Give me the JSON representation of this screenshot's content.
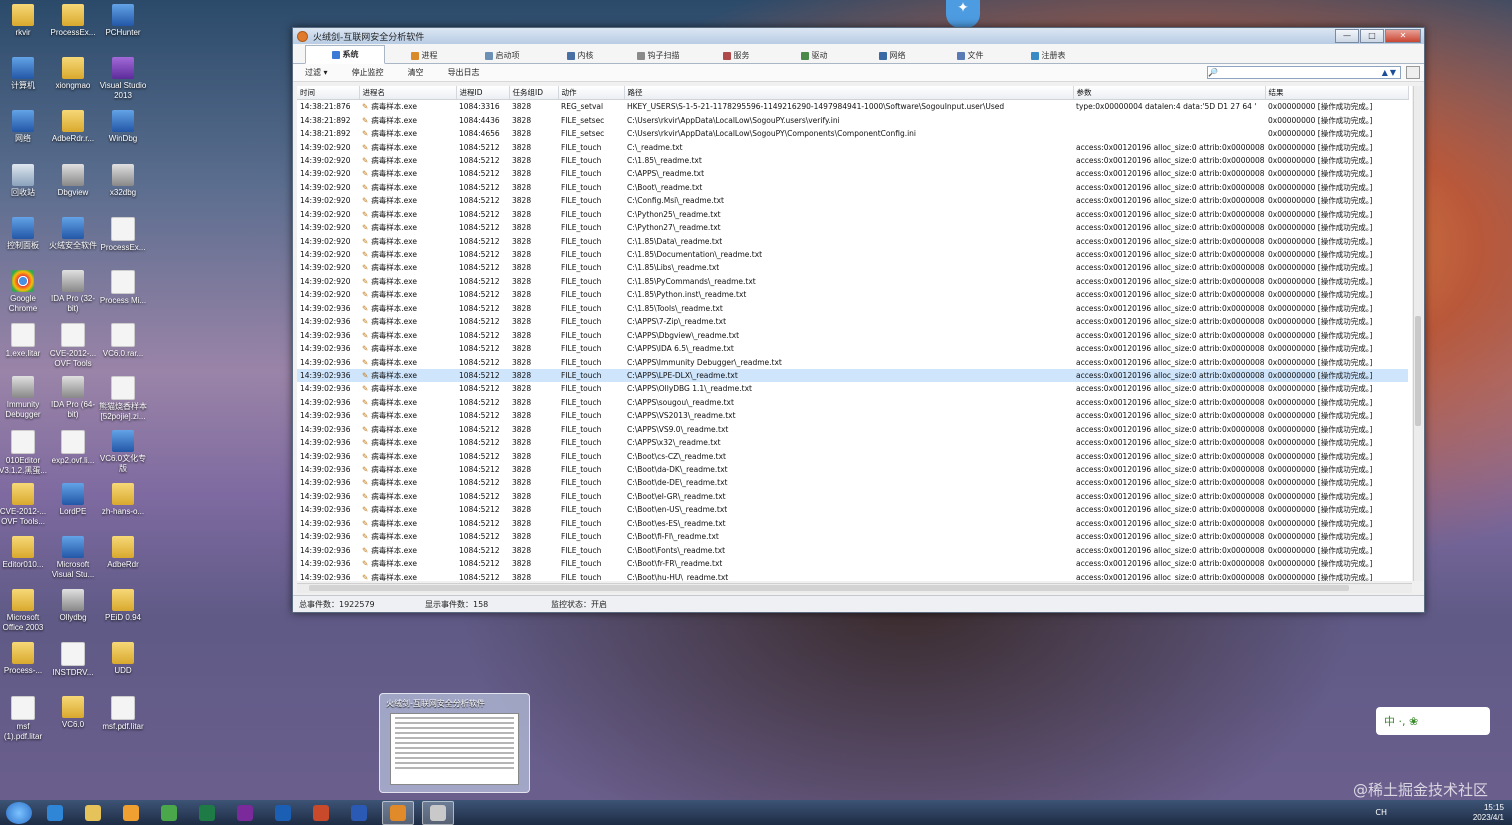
{
  "window": {
    "title": "火绒剑-互联网安全分析软件",
    "btn_min": "—",
    "btn_max": "□",
    "btn_close": "✕"
  },
  "tabs": [
    {
      "label": "系统",
      "color": "#3a7bd5"
    },
    {
      "label": "进程",
      "color": "#d98a2b"
    },
    {
      "label": "启动项",
      "color": "#6b8fb5"
    },
    {
      "label": "内核",
      "color": "#4a6fa5"
    },
    {
      "label": "钩子扫描",
      "color": "#8a8a8a"
    },
    {
      "label": "服务",
      "color": "#b04a4a"
    },
    {
      "label": "驱动",
      "color": "#4a8a4a"
    },
    {
      "label": "网络",
      "color": "#3a6aa5"
    },
    {
      "label": "文件",
      "color": "#5a7ab5"
    },
    {
      "label": "注册表",
      "color": "#3a8ac5"
    }
  ],
  "toolbar": {
    "filter": "过滤 ▾",
    "stop": "停止监控",
    "clear": "清空",
    "export": "导出日志",
    "search_icon": "🔎",
    "search_arrows": "▲▼"
  },
  "columns": [
    "时间",
    "进程名",
    "进程ID",
    "任务组ID",
    "动作",
    "路径",
    "参数",
    "结果"
  ],
  "rows": [
    [
      "14:38:21:876",
      "病毒样本.exe",
      "1084:3316",
      "3828",
      "REG_setval",
      "HKEY_USERS\\S-1-5-21-1178295596-1149216290-1497984941-1000\\Software\\SogouInput.user\\Used",
      "type:0x00000004 datalen:4 data:'5D D1 27 64 '",
      "0x00000000 [操作成功完成。]"
    ],
    [
      "14:38:21:892",
      "病毒样本.exe",
      "1084:4436",
      "3828",
      "FILE_setsec",
      "C:\\Users\\rkvir\\AppData\\LocalLow\\SogouPY.users\\verify.ini",
      "",
      "0x00000000 [操作成功完成。]"
    ],
    [
      "14:38:21:892",
      "病毒样本.exe",
      "1084:4656",
      "3828",
      "FILE_setsec",
      "C:\\Users\\rkvir\\AppData\\LocalLow\\SogouPY\\Components\\ComponentConfig.ini",
      "",
      "0x00000000 [操作成功完成。]"
    ],
    [
      "14:39:02:920",
      "病毒样本.exe",
      "1084:5212",
      "3828",
      "FILE_touch",
      "C:\\_readme.txt",
      "access:0x00120196 alloc_size:0 attrib:0x00000080...",
      "0x00000000 [操作成功完成。]"
    ],
    [
      "14:39:02:920",
      "病毒样本.exe",
      "1084:5212",
      "3828",
      "FILE_touch",
      "C:\\1.85\\_readme.txt",
      "access:0x00120196 alloc_size:0 attrib:0x00000080...",
      "0x00000000 [操作成功完成。]"
    ],
    [
      "14:39:02:920",
      "病毒样本.exe",
      "1084:5212",
      "3828",
      "FILE_touch",
      "C:\\APPS\\_readme.txt",
      "access:0x00120196 alloc_size:0 attrib:0x00000080...",
      "0x00000000 [操作成功完成。]"
    ],
    [
      "14:39:02:920",
      "病毒样本.exe",
      "1084:5212",
      "3828",
      "FILE_touch",
      "C:\\Boot\\_readme.txt",
      "access:0x00120196 alloc_size:0 attrib:0x00000080...",
      "0x00000000 [操作成功完成。]"
    ],
    [
      "14:39:02:920",
      "病毒样本.exe",
      "1084:5212",
      "3828",
      "FILE_touch",
      "C:\\Config.Msi\\_readme.txt",
      "access:0x00120196 alloc_size:0 attrib:0x00000080...",
      "0x00000000 [操作成功完成。]"
    ],
    [
      "14:39:02:920",
      "病毒样本.exe",
      "1084:5212",
      "3828",
      "FILE_touch",
      "C:\\Python25\\_readme.txt",
      "access:0x00120196 alloc_size:0 attrib:0x00000080...",
      "0x00000000 [操作成功完成。]"
    ],
    [
      "14:39:02:920",
      "病毒样本.exe",
      "1084:5212",
      "3828",
      "FILE_touch",
      "C:\\Python27\\_readme.txt",
      "access:0x00120196 alloc_size:0 attrib:0x00000080...",
      "0x00000000 [操作成功完成。]"
    ],
    [
      "14:39:02:920",
      "病毒样本.exe",
      "1084:5212",
      "3828",
      "FILE_touch",
      "C:\\1.85\\Data\\_readme.txt",
      "access:0x00120196 alloc_size:0 attrib:0x00000080...",
      "0x00000000 [操作成功完成。]"
    ],
    [
      "14:39:02:920",
      "病毒样本.exe",
      "1084:5212",
      "3828",
      "FILE_touch",
      "C:\\1.85\\Documentation\\_readme.txt",
      "access:0x00120196 alloc_size:0 attrib:0x00000080...",
      "0x00000000 [操作成功完成。]"
    ],
    [
      "14:39:02:920",
      "病毒样本.exe",
      "1084:5212",
      "3828",
      "FILE_touch",
      "C:\\1.85\\Libs\\_readme.txt",
      "access:0x00120196 alloc_size:0 attrib:0x00000080...",
      "0x00000000 [操作成功完成。]"
    ],
    [
      "14:39:02:920",
      "病毒样本.exe",
      "1084:5212",
      "3828",
      "FILE_touch",
      "C:\\1.85\\PyCommands\\_readme.txt",
      "access:0x00120196 alloc_size:0 attrib:0x00000080...",
      "0x00000000 [操作成功完成。]"
    ],
    [
      "14:39:02:920",
      "病毒样本.exe",
      "1084:5212",
      "3828",
      "FILE_touch",
      "C:\\1.85\\Python.inst\\_readme.txt",
      "access:0x00120196 alloc_size:0 attrib:0x00000080...",
      "0x00000000 [操作成功完成。]"
    ],
    [
      "14:39:02:936",
      "病毒样本.exe",
      "1084:5212",
      "3828",
      "FILE_touch",
      "C:\\1.85\\Tools\\_readme.txt",
      "access:0x00120196 alloc_size:0 attrib:0x00000080...",
      "0x00000000 [操作成功完成。]"
    ],
    [
      "14:39:02:936",
      "病毒样本.exe",
      "1084:5212",
      "3828",
      "FILE_touch",
      "C:\\APPS\\7-Zip\\_readme.txt",
      "access:0x00120196 alloc_size:0 attrib:0x00000080...",
      "0x00000000 [操作成功完成。]"
    ],
    [
      "14:39:02:936",
      "病毒样本.exe",
      "1084:5212",
      "3828",
      "FILE_touch",
      "C:\\APPS\\Dbgview\\_readme.txt",
      "access:0x00120196 alloc_size:0 attrib:0x00000080...",
      "0x00000000 [操作成功完成。]"
    ],
    [
      "14:39:02:936",
      "病毒样本.exe",
      "1084:5212",
      "3828",
      "FILE_touch",
      "C:\\APPS\\IDA 6.5\\_readme.txt",
      "access:0x00120196 alloc_size:0 attrib:0x00000080...",
      "0x00000000 [操作成功完成。]"
    ],
    [
      "14:39:02:936",
      "病毒样本.exe",
      "1084:5212",
      "3828",
      "FILE_touch",
      "C:\\APPS\\Immunity Debugger\\_readme.txt",
      "access:0x00120196 alloc_size:0 attrib:0x00000080...",
      "0x00000000 [操作成功完成。]"
    ],
    [
      "14:39:02:936",
      "病毒样本.exe",
      "1084:5212",
      "3828",
      "FILE_touch",
      "C:\\APPS\\LPE-DLX\\_readme.txt",
      "access:0x00120196 alloc_size:0 attrib:0x00000080...",
      "0x00000000 [操作成功完成。]"
    ],
    [
      "14:39:02:936",
      "病毒样本.exe",
      "1084:5212",
      "3828",
      "FILE_touch",
      "C:\\APPS\\OllyDBG 1.1\\_readme.txt",
      "access:0x00120196 alloc_size:0 attrib:0x00000080...",
      "0x00000000 [操作成功完成。]"
    ],
    [
      "14:39:02:936",
      "病毒样本.exe",
      "1084:5212",
      "3828",
      "FILE_touch",
      "C:\\APPS\\sougou\\_readme.txt",
      "access:0x00120196 alloc_size:0 attrib:0x00000080...",
      "0x00000000 [操作成功完成。]"
    ],
    [
      "14:39:02:936",
      "病毒样本.exe",
      "1084:5212",
      "3828",
      "FILE_touch",
      "C:\\APPS\\VS2013\\_readme.txt",
      "access:0x00120196 alloc_size:0 attrib:0x00000080...",
      "0x00000000 [操作成功完成。]"
    ],
    [
      "14:39:02:936",
      "病毒样本.exe",
      "1084:5212",
      "3828",
      "FILE_touch",
      "C:\\APPS\\VS9.0\\_readme.txt",
      "access:0x00120196 alloc_size:0 attrib:0x00000080...",
      "0x00000000 [操作成功完成。]"
    ],
    [
      "14:39:02:936",
      "病毒样本.exe",
      "1084:5212",
      "3828",
      "FILE_touch",
      "C:\\APPS\\x32\\_readme.txt",
      "access:0x00120196 alloc_size:0 attrib:0x00000080...",
      "0x00000000 [操作成功完成。]"
    ],
    [
      "14:39:02:936",
      "病毒样本.exe",
      "1084:5212",
      "3828",
      "FILE_touch",
      "C:\\Boot\\cs-CZ\\_readme.txt",
      "access:0x00120196 alloc_size:0 attrib:0x00000080...",
      "0x00000000 [操作成功完成。]"
    ],
    [
      "14:39:02:936",
      "病毒样本.exe",
      "1084:5212",
      "3828",
      "FILE_touch",
      "C:\\Boot\\da-DK\\_readme.txt",
      "access:0x00120196 alloc_size:0 attrib:0x00000080...",
      "0x00000000 [操作成功完成。]"
    ],
    [
      "14:39:02:936",
      "病毒样本.exe",
      "1084:5212",
      "3828",
      "FILE_touch",
      "C:\\Boot\\de-DE\\_readme.txt",
      "access:0x00120196 alloc_size:0 attrib:0x00000080...",
      "0x00000000 [操作成功完成。]"
    ],
    [
      "14:39:02:936",
      "病毒样本.exe",
      "1084:5212",
      "3828",
      "FILE_touch",
      "C:\\Boot\\el-GR\\_readme.txt",
      "access:0x00120196 alloc_size:0 attrib:0x00000080...",
      "0x00000000 [操作成功完成。]"
    ],
    [
      "14:39:02:936",
      "病毒样本.exe",
      "1084:5212",
      "3828",
      "FILE_touch",
      "C:\\Boot\\en-US\\_readme.txt",
      "access:0x00120196 alloc_size:0 attrib:0x00000080...",
      "0x00000000 [操作成功完成。]"
    ],
    [
      "14:39:02:936",
      "病毒样本.exe",
      "1084:5212",
      "3828",
      "FILE_touch",
      "C:\\Boot\\es-ES\\_readme.txt",
      "access:0x00120196 alloc_size:0 attrib:0x00000080...",
      "0x00000000 [操作成功完成。]"
    ],
    [
      "14:39:02:936",
      "病毒样本.exe",
      "1084:5212",
      "3828",
      "FILE_touch",
      "C:\\Boot\\fi-FI\\_readme.txt",
      "access:0x00120196 alloc_size:0 attrib:0x00000080...",
      "0x00000000 [操作成功完成。]"
    ],
    [
      "14:39:02:936",
      "病毒样本.exe",
      "1084:5212",
      "3828",
      "FILE_touch",
      "C:\\Boot\\Fonts\\_readme.txt",
      "access:0x00120196 alloc_size:0 attrib:0x00000080...",
      "0x00000000 [操作成功完成。]"
    ],
    [
      "14:39:02:936",
      "病毒样本.exe",
      "1084:5212",
      "3828",
      "FILE_touch",
      "C:\\Boot\\fr-FR\\_readme.txt",
      "access:0x00120196 alloc_size:0 attrib:0x00000080...",
      "0x00000000 [操作成功完成。]"
    ],
    [
      "14:39:02:936",
      "病毒样本.exe",
      "1084:5212",
      "3828",
      "FILE_touch",
      "C:\\Boot\\hu-HU\\_readme.txt",
      "access:0x00120196 alloc_size:0 attrib:0x00000080...",
      "0x00000000 [操作成功完成。]"
    ]
  ],
  "selected_row": 20,
  "status": {
    "total": "总事件数：1922579",
    "shown": "显示事件数：158",
    "monitor": "监控状态：开启"
  },
  "desktop_icons": [
    {
      "label": "rkvir",
      "kind": "folder"
    },
    {
      "label": "ProcessEx...",
      "kind": "folder"
    },
    {
      "label": "PCHunter",
      "kind": "app"
    },
    {
      "label": "计算机",
      "kind": "app"
    },
    {
      "label": "xiongmao",
      "kind": "folder"
    },
    {
      "label": "Visual Studio 2013",
      "kind": "vs"
    },
    {
      "label": "网络",
      "kind": "app"
    },
    {
      "label": "AdbeRdr.r...",
      "kind": "folder"
    },
    {
      "label": "WinDbg",
      "kind": "app"
    },
    {
      "label": "回收站",
      "kind": "recycle"
    },
    {
      "label": "Dbgview",
      "kind": "bug"
    },
    {
      "label": "x32dbg",
      "kind": "bug"
    },
    {
      "label": "控制面板",
      "kind": "app"
    },
    {
      "label": "火绒安全软件",
      "kind": "app"
    },
    {
      "label": "ProcessEx...",
      "kind": "file"
    },
    {
      "label": "Google Chrome",
      "kind": "chrome"
    },
    {
      "label": "IDA Pro (32-bit)",
      "kind": "bug"
    },
    {
      "label": "Process Mi...",
      "kind": "file"
    },
    {
      "label": "1.exe.litar",
      "kind": "file"
    },
    {
      "label": "CVE-2012-... OVF Tools",
      "kind": "file"
    },
    {
      "label": "VC6.0.rar...",
      "kind": "file"
    },
    {
      "label": "Immunity Debugger",
      "kind": "bug"
    },
    {
      "label": "IDA Pro (64-bit)",
      "kind": "bug"
    },
    {
      "label": "熊猫烧香样本 [52pojie].zi...",
      "kind": "file"
    },
    {
      "label": "010Editor V3.1.2.黑蛋...",
      "kind": "file"
    },
    {
      "label": "exp2.ovf.li...",
      "kind": "file"
    },
    {
      "label": "VC6.0文化专版",
      "kind": "app"
    },
    {
      "label": "CVE-2012-... OVF Tools...",
      "kind": "folder"
    },
    {
      "label": "LordPE",
      "kind": "app"
    },
    {
      "label": "zh-hans-o...",
      "kind": "folder"
    },
    {
      "label": "Editor010...",
      "kind": "folder"
    },
    {
      "label": "Microsoft Visual Stu...",
      "kind": "app"
    },
    {
      "label": "AdbeRdr",
      "kind": "folder"
    },
    {
      "label": "Microsoft Office 2003",
      "kind": "folder"
    },
    {
      "label": "Ollydbg",
      "kind": "bug"
    },
    {
      "label": "PEiD 0.94",
      "kind": "folder"
    },
    {
      "label": "Process-...",
      "kind": "folder"
    },
    {
      "label": "INSTDRV...",
      "kind": "file"
    },
    {
      "label": "UDD",
      "kind": "folder"
    },
    {
      "label": "msf (1).pdf.litar",
      "kind": "file"
    },
    {
      "label": "VC6.0",
      "kind": "folder"
    },
    {
      "label": "msf.pdf.litar",
      "kind": "file"
    }
  ],
  "taskbar": {
    "apps": [
      {
        "name": "ie",
        "color": "#2f86d6"
      },
      {
        "name": "explorer",
        "color": "#e5c35a"
      },
      {
        "name": "media",
        "color": "#f0a030"
      },
      {
        "name": "chrome",
        "color": "#4aa84a"
      },
      {
        "name": "excel",
        "color": "#1e7b45"
      },
      {
        "name": "onenote",
        "color": "#7a2a9a"
      },
      {
        "name": "outlook",
        "color": "#1a5fb4"
      },
      {
        "name": "powerpoint",
        "color": "#c84a2a"
      },
      {
        "name": "word",
        "color": "#2a5ab4"
      },
      {
        "name": "huorong",
        "color": "#e08a2a"
      },
      {
        "name": "huorong-sword",
        "color": "#c9c9c9"
      }
    ],
    "lang": "CH",
    "time": "15:15",
    "date": "2023/4/1"
  },
  "preview_title": "火绒剑-互联网安全分析软件",
  "ime_label": "中 ·, ❀",
  "watermark": "@稀土掘金技术社区"
}
